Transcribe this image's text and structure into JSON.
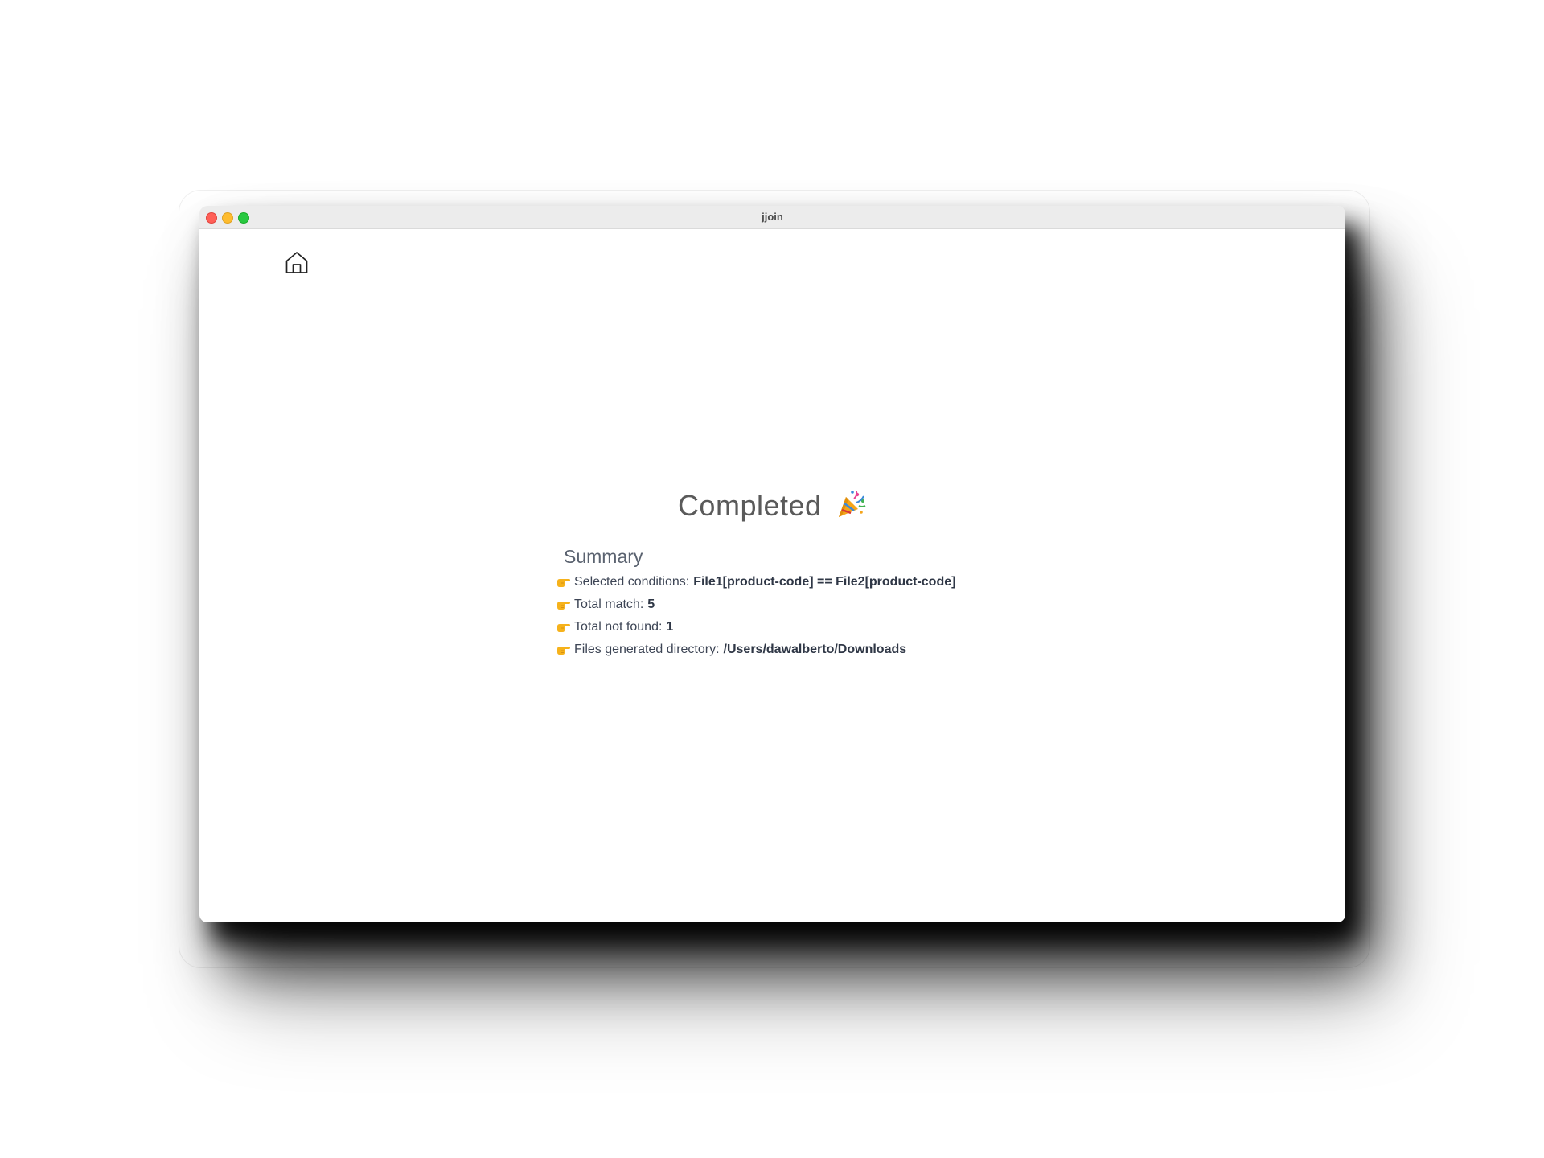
{
  "window": {
    "title": "jjoin"
  },
  "main": {
    "heading": "Completed",
    "heading_icon": "party-popper-emoji",
    "summary_title": "Summary",
    "rows": [
      {
        "label": "Selected conditions:",
        "value": "File1[product-code] == File2[product-code]",
        "icon": "pointing-hand-emoji"
      },
      {
        "label": "Total match:",
        "value": "5",
        "icon": "pointing-hand-emoji"
      },
      {
        "label": "Total not found:",
        "value": "1",
        "icon": "pointing-hand-emoji"
      },
      {
        "label": "Files generated directory:",
        "value": "/Users/dawalberto/Downloads",
        "icon": "pointing-hand-emoji"
      }
    ]
  },
  "toolbar": {
    "home_icon": "home-icon"
  },
  "colors": {
    "close": "#ff5f57",
    "minimize": "#febc2e",
    "zoom": "#28c840",
    "pointer_emoji": "#f6b21b"
  }
}
